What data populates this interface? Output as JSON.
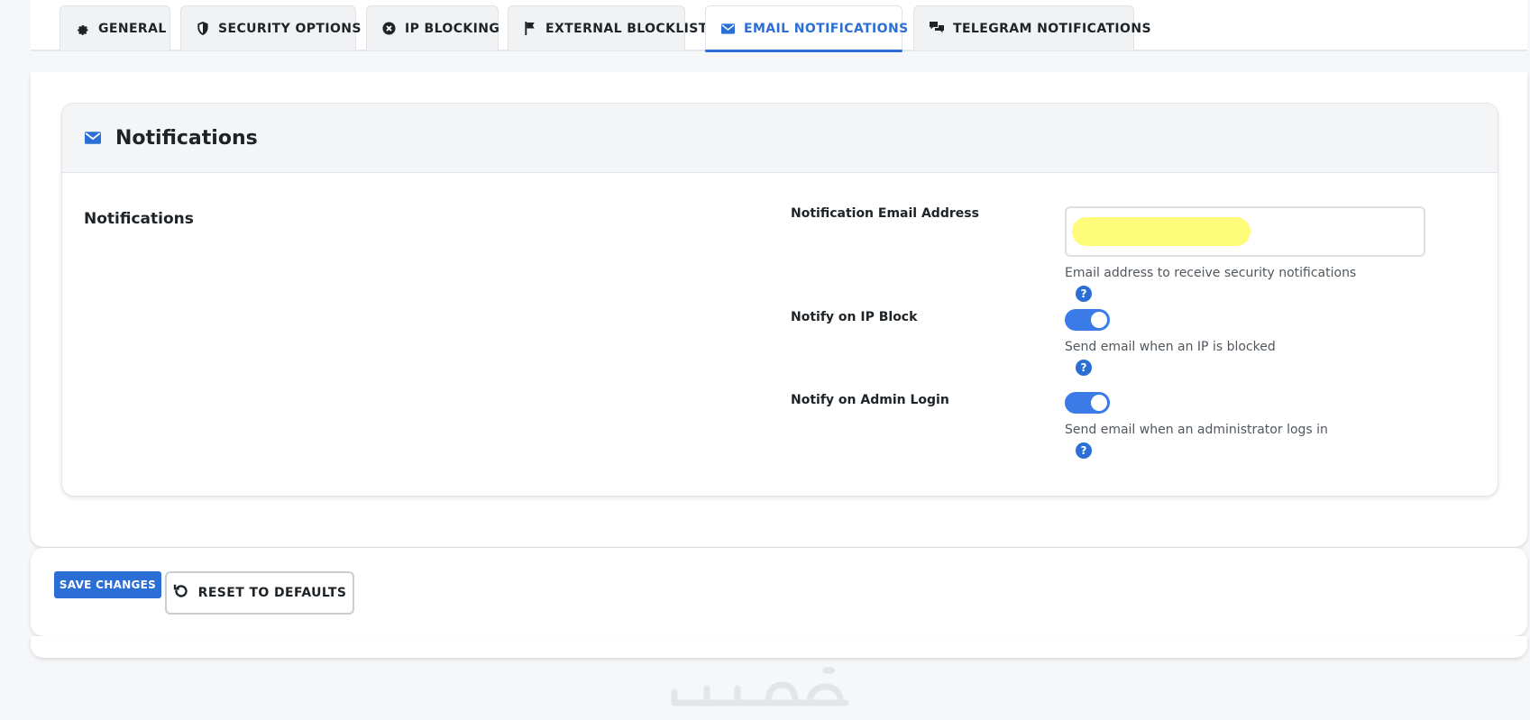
{
  "tabs": [
    {
      "label": "GENERAL",
      "icon": "gear-icon",
      "active": false
    },
    {
      "label": "SECURITY OPTIONS",
      "icon": "shield-icon",
      "active": false
    },
    {
      "label": "IP BLOCKING",
      "icon": "circle-x-icon",
      "active": false
    },
    {
      "label": "EXTERNAL BLOCKLIST",
      "icon": "flag-icon",
      "active": false
    },
    {
      "label": "EMAIL NOTIFICATIONS",
      "icon": "envelope-icon",
      "active": true
    },
    {
      "label": "TELEGRAM NOTIFICATIONS",
      "icon": "chat-icon",
      "active": false
    }
  ],
  "card": {
    "title": "Notifications",
    "icon": "envelope-icon",
    "section_label": "Notifications"
  },
  "fields": {
    "email": {
      "label": "Notification Email Address",
      "value": "",
      "description": "Email address to receive security notifications"
    },
    "ip_block": {
      "label": "Notify on IP Block",
      "enabled": true,
      "description": "Send email when an IP is blocked"
    },
    "admin_login": {
      "label": "Notify on Admin Login",
      "enabled": true,
      "description": "Send email when an administrator logs in"
    }
  },
  "help_glyph": "?",
  "actions": {
    "save_label": "SAVE CHANGES",
    "reset_label": "RESET TO DEFAULTS"
  },
  "colors": {
    "accent": "#2b6fd6",
    "toggle_on": "#3b7be8",
    "redaction": "#fefc7a"
  }
}
